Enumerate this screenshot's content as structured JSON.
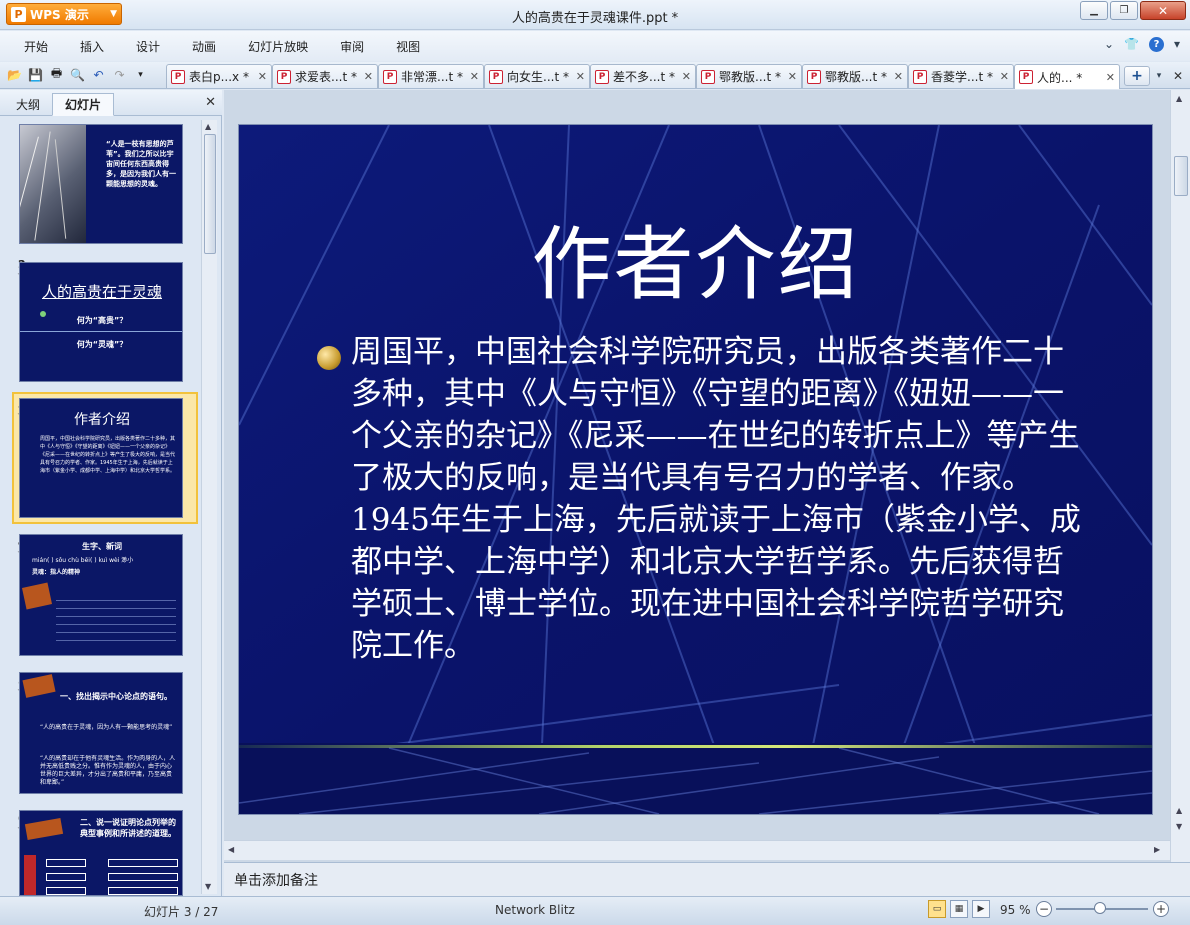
{
  "app": {
    "button_label": "WPS 演示",
    "window_title": "人的高贵在于灵魂课件.ppt *"
  },
  "menu": [
    "开始",
    "插入",
    "设计",
    "动画",
    "幻灯片放映",
    "审阅",
    "视图"
  ],
  "tabs": [
    {
      "label": "表白p...x *",
      "active": false
    },
    {
      "label": "求爱表...t *",
      "active": false
    },
    {
      "label": "非常漂...t *",
      "active": false
    },
    {
      "label": "向女生...t *",
      "active": false
    },
    {
      "label": "差不多...t *",
      "active": false
    },
    {
      "label": "鄂教版...t *",
      "active": false
    },
    {
      "label": "鄂教版...t *",
      "active": false
    },
    {
      "label": "香菱学...t *",
      "active": false
    },
    {
      "label": "人的... *",
      "active": true
    }
  ],
  "panel": {
    "tab_outline": "大纲",
    "tab_slides": "幻灯片"
  },
  "thumbnails": [
    {
      "num": "1",
      "text": "“人是一枝有思想的芦苇”。我们之所以比宇宙间任何东西高贵得多，是因为我们人有一颗能思想的灵魂。"
    },
    {
      "num": "2",
      "title": "人的高贵在于灵魂",
      "q1": "何为“高贵”？",
      "q2": "何为“灵魂”？"
    },
    {
      "num": "3",
      "title": "作者介绍",
      "text": "周国平，中国社会科学院研究员，出版各类著作二十多种，其中《人与守恒》《守望的距离》《妞妞——一个父亲的杂记》《尼采——在世纪的转折点上》等产生了极大的反响，是当代具有号召力的学者、作家。1945年生于上海，先后就读于上海市（紫金小学、成都中学、上海中学）和北京大学哲学系。"
    },
    {
      "num": "4",
      "title": "生字、新词",
      "line1": "mián(    )    sǒu    chù bēi(    )    kuì    wèi  渺小",
      "line2": "灵魂：指人的精神"
    },
    {
      "num": "5",
      "title": "一、找出揭示中心论点的语句。",
      "text1": "“人的高贵在于灵魂，因为人有一颗能思考的灵魂”",
      "text2": "“人的高贵却在于他有灵魂生活。作为肉身的人，人并无高低贵贱之分。惟有作为灵魂的人，由于内心世界的巨大差异，才分出了高贵和平庸，乃至高贵和卑鄙。”"
    },
    {
      "num": "6",
      "title": "二、说一说证明论点列举的典型事例和所讲述的道理。"
    }
  ],
  "slide": {
    "title": "作者介绍",
    "body": "周国平，中国社会科学院研究员，出版各类著作二十多种，其中《人与守恒》《守望的距离》《妞妞——一个父亲的杂记》《尼采——在世纪的转折点上》等产生了极大的反响，是当代具有号召力的学者、作家。1945年生于上海，先后就读于上海市（紫金小学、成都中学、上海中学）和北京大学哲学系。先后获得哲学硕士、博士学位。现在进中国社会科学院哲学研究院工作。"
  },
  "notes": {
    "placeholder": "单击添加备注"
  },
  "status": {
    "slide_pos": "幻灯片 3 / 27",
    "theme": "Network Blitz",
    "zoom": "95 %"
  },
  "colors": {
    "slide_bg": "#0a1470",
    "accent_orange": "#f07a00",
    "selection": "#f2c23c"
  }
}
